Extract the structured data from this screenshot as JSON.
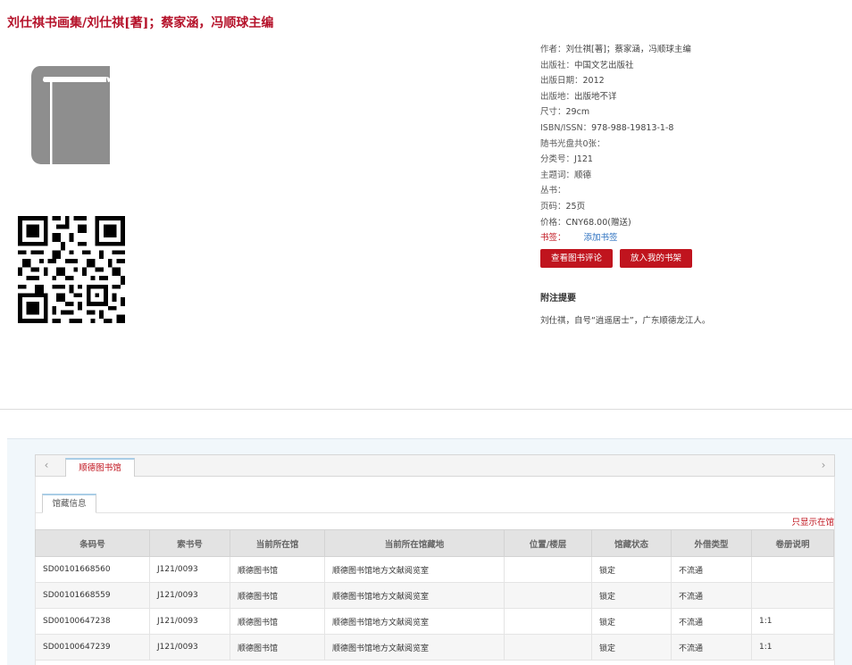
{
  "title": "刘仕祺书画集/刘仕祺[著]；蔡家涵，冯顺球主编",
  "meta": [
    {
      "label": "作者：",
      "value": "刘仕祺[著]；蔡家涵，冯顺球主编"
    },
    {
      "label": "出版社：",
      "value": "中国文艺出版社"
    },
    {
      "label": "出版日期：",
      "value": "2012"
    },
    {
      "label": "出版地：",
      "value": "出版地不详"
    },
    {
      "label": "尺寸：",
      "value": "29cm"
    },
    {
      "label": "ISBN/ISSN：",
      "value": "978-988-19813-1-8"
    },
    {
      "label": "随书光盘共0张：",
      "value": ""
    },
    {
      "label": "分类号：",
      "value": "J121"
    },
    {
      "label": "主题词：",
      "value": "顺德"
    },
    {
      "label": "丛书：",
      "value": ""
    },
    {
      "label": "页码：",
      "value": "25页"
    },
    {
      "label": "价格：",
      "value": "CNY68.00(赠送)"
    }
  ],
  "bookmark": {
    "label": "书签：",
    "link": "添加书签"
  },
  "buttons": {
    "review": "查看图书评论",
    "shelf": "放入我的书架"
  },
  "note": {
    "heading": "附注提要",
    "text": "刘仕祺，自号“逍遥居士”，广东顺德龙江人。"
  },
  "tabs": {
    "prev": "‹",
    "next": "›",
    "library": "顺德图书馆"
  },
  "holdings": {
    "subtab": "馆藏信息",
    "only_show": "只显示在馆",
    "columns": [
      "条码号",
      "索书号",
      "当前所在馆",
      "当前所在馆藏地",
      "位置/楼层",
      "馆藏状态",
      "外借类型",
      "卷册说明"
    ],
    "rows": [
      [
        "SD00101668560",
        "J121/0093",
        "顺德图书馆",
        "顺德图书馆地方文献阅览室",
        "",
        "锁定",
        "不流通",
        ""
      ],
      [
        "SD00101668559",
        "J121/0093",
        "顺德图书馆",
        "顺德图书馆地方文献阅览室",
        "",
        "锁定",
        "不流通",
        ""
      ],
      [
        "SD00100647238",
        "J121/0093",
        "顺德图书馆",
        "顺德图书馆地方文献阅览室",
        "",
        "锁定",
        "不流通",
        "1:1"
      ],
      [
        "SD00100647239",
        "J121/0093",
        "顺德图书馆",
        "顺德图书馆地方文献阅览室",
        "",
        "锁定",
        "不流通",
        "1:1"
      ]
    ]
  },
  "colors": {
    "accent": "#c0141e",
    "title": "#b5122a",
    "link": "#2a6fbf"
  }
}
